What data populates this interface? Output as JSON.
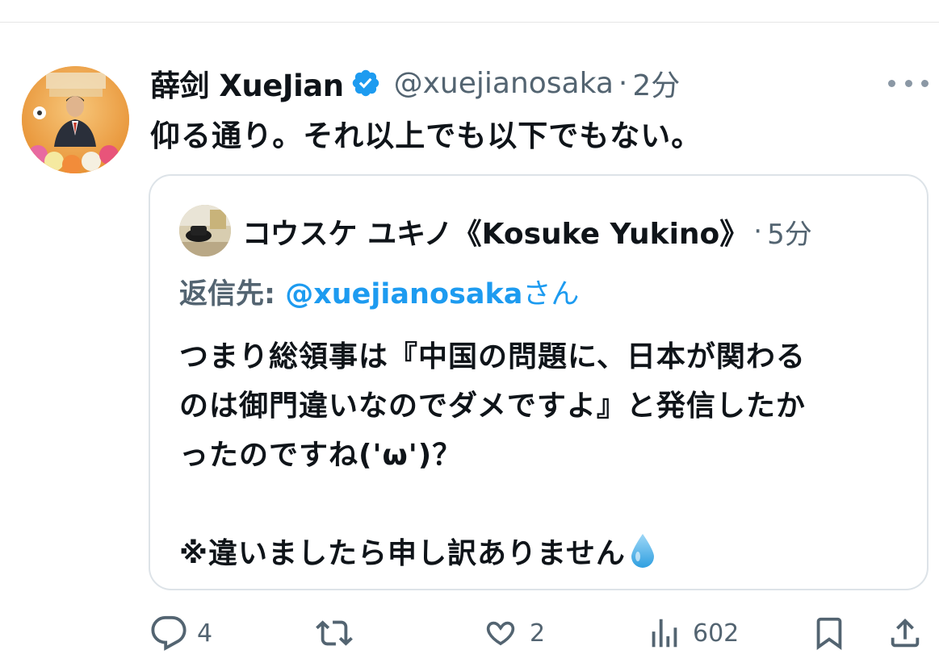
{
  "tweet": {
    "author": {
      "display_name": "薛剑 XueJian",
      "handle": "@xuejianosaka",
      "verified": true,
      "avatar_icon": "consul-portrait-avatar"
    },
    "separator": "·",
    "time_ago": "2分",
    "text": "仰る通り。それ以上でも以下でもない。"
  },
  "quote": {
    "author": {
      "display_name": "コウスケ ユキノ《Kosuke Yukino》",
      "avatar_icon": "user-avatar"
    },
    "separator": "·",
    "time_ago": "5分",
    "reply_to": {
      "prefix": "返信先: ",
      "handle": "@xuejianosaka",
      "suffix": "さん"
    },
    "body_lines": [
      "つまり総領事は『中国の問題に、日本が関わる",
      "のは御門違いなのでダメですよ』と発信したか",
      "ったのですね('ω')？",
      "",
      "※違いましたら申し訳ありません"
    ],
    "emoji": "water-drop-icon"
  },
  "actions": {
    "reply": {
      "icon": "reply-icon",
      "count": "4"
    },
    "retweet": {
      "icon": "retweet-icon",
      "count": ""
    },
    "like": {
      "icon": "heart-icon",
      "count": "2"
    },
    "views": {
      "icon": "views-icon",
      "count": "602"
    },
    "bookmark": {
      "icon": "bookmark-icon"
    },
    "share": {
      "icon": "share-icon"
    }
  },
  "colors": {
    "text_primary": "#0f1419",
    "text_secondary": "#536471",
    "link_blue": "#1d9bf0",
    "border": "#dde3e8"
  }
}
